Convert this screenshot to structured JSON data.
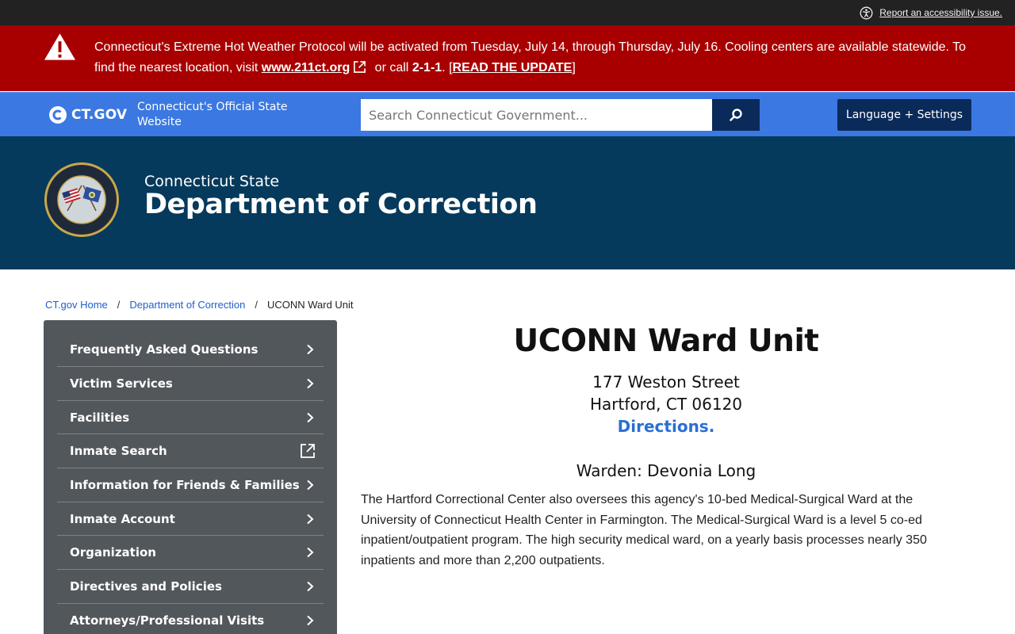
{
  "utility": {
    "accessibility_link": "Report an accessibility issue."
  },
  "alert": {
    "text_before": "Connecticut's Extreme Hot Weather Protocol will be activated from Tuesday, July 14, through Thursday, July 16. Cooling centers are available statewide. To find the nearest location, visit ",
    "link_text": "www.211ct.org",
    "text_middle": " or call ",
    "phone": "2-1-1",
    "text_after": ". [",
    "update_link": "READ THE UPDATE",
    "text_end": "]"
  },
  "ctgov": {
    "logo_text": "CT.GOV",
    "tagline": "Connecticut's Official State Website",
    "search_placeholder": "Search Connecticut Government...",
    "language_button": "Language + Settings"
  },
  "agency": {
    "subtitle": "Connecticut State",
    "title": "Department of Correction"
  },
  "breadcrumb": {
    "items": [
      "CT.gov Home",
      "Department of Correction"
    ],
    "current": "UCONN Ward Unit",
    "separator": "/"
  },
  "sidebar": {
    "items": [
      {
        "label": "Frequently Asked Questions",
        "icon": "chevron-right-icon"
      },
      {
        "label": "Victim Services",
        "icon": "chevron-right-icon"
      },
      {
        "label": "Facilities",
        "icon": "chevron-right-icon"
      },
      {
        "label": "Inmate Search",
        "icon": "external-link-icon"
      },
      {
        "label": "Information for Friends & Families",
        "icon": "chevron-right-icon"
      },
      {
        "label": "Inmate Account",
        "icon": "chevron-right-icon"
      },
      {
        "label": "Organization",
        "icon": "chevron-right-icon"
      },
      {
        "label": "Directives and Policies",
        "icon": "chevron-right-icon"
      },
      {
        "label": "Attorneys/Professional Visits",
        "icon": "chevron-right-icon"
      }
    ]
  },
  "main": {
    "title": "UCONN Ward Unit",
    "address_line1": "177 Weston Street",
    "address_line2": "Hartford, CT 06120",
    "directions": "Directions.",
    "warden": "Warden: Devonia Long",
    "description": "The Hartford Correctional Center also oversees this agency's 10-bed Medical-Surgical Ward at the University of Connecticut Health Center in Farmington. The Medical-Surgical Ward is a level 5 co-ed inpatient/outpatient program. The high security medical ward, on a yearly basis processes nearly 350 inpatients and more than 2,200 outpatients."
  },
  "colors": {
    "utility_bar": "#222222",
    "alert_bg": "#a80000",
    "ctgov_bar": "#3b78e1",
    "button_navy": "#0a2a5a",
    "agency_header": "#053a5c",
    "sidebar_bg": "#52575c",
    "link_blue": "#2a6fd6"
  }
}
